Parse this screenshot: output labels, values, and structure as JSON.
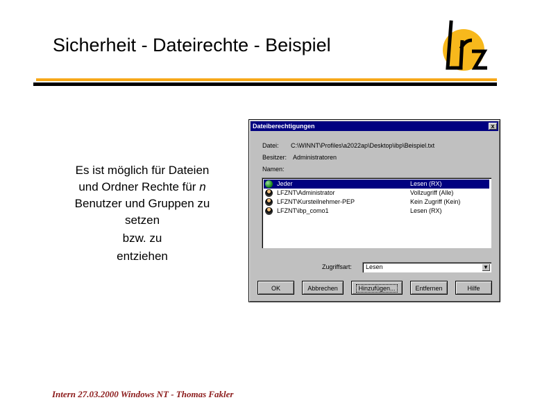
{
  "slide": {
    "title": "Sicherheit - Dateirechte - Beispiel",
    "body_lines": [
      "Es ist möglich für Dateien",
      "und Ordner Rechte für ",
      "n",
      "Benutzer und Gruppen zu",
      "setzen",
      "bzw. zu",
      "entziehen"
    ],
    "footer": "Intern 27.03.2000 Windows NT - Thomas Fakler",
    "logo_text": "Lrz",
    "colors": {
      "accent_bar": "#f7a818",
      "footer_text": "#8b1a1a",
      "logo_circle": "#f7b81c"
    }
  },
  "dialog": {
    "title": "Dateiberechtigungen",
    "close_label": "x",
    "file_label": "Datei:",
    "file_value": "C:\\WINNT\\Profiles\\a2022ap\\Desktop\\ibp\\Beispiel.txt",
    "owner_label": "Besitzer:",
    "owner_value": "Administratoren",
    "names_label": "Namen:",
    "entries": [
      {
        "name": "Jeder",
        "rights": "Lesen (RX)",
        "icon": "globe-icon",
        "selected": true
      },
      {
        "name": "LFZNT\\Administrator",
        "rights": "Vollzugriff (Alle)",
        "icon": "user-icon",
        "selected": false
      },
      {
        "name": "LFZNT\\Kursteilnehmer-PEP",
        "rights": "Kein Zugriff (Kein)",
        "icon": "user-icon",
        "selected": false
      },
      {
        "name": "LFZNT\\ibp_como1",
        "rights": "Lesen (RX)",
        "icon": "user-icon",
        "selected": false
      }
    ],
    "access_label": "Zugriffsart:",
    "access_value": "Lesen",
    "buttons": {
      "ok": "OK",
      "cancel": "Abbrechen",
      "add": "Hinzufügen...",
      "remove": "Entfernen",
      "help": "Hilfe"
    }
  }
}
